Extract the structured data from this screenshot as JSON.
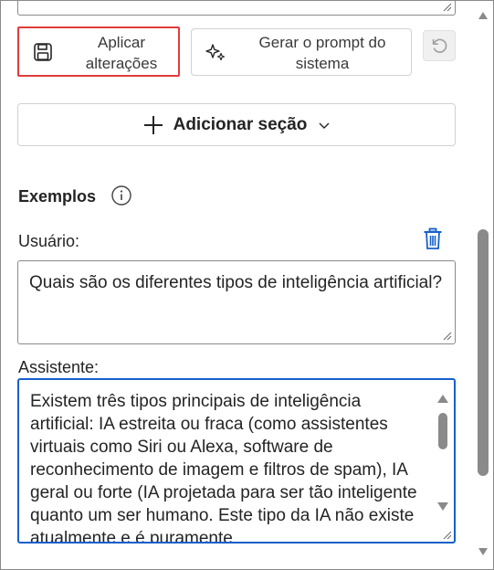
{
  "toolbar": {
    "apply_label": "Aplicar alterações",
    "apply_icon": "save-icon",
    "generate_label": "Gerar o prompt do sistema",
    "generate_icon": "sparkle-icon",
    "undo_icon": "undo-icon"
  },
  "add_section": {
    "label": "Adicionar seção",
    "icon": "plus-icon",
    "chevron": "chevron-down-icon"
  },
  "examples": {
    "title": "Exemplos",
    "info_icon": "info-icon",
    "user_label": "Usuário:",
    "user_value": "Quais são os diferentes tipos de inteligência artificial?",
    "delete_icon": "trash-icon",
    "assistant_label": "Assistente:",
    "assistant_value": "Existem três tipos principais de inteligência artificial: IA estreita ou fraca (como assistentes virtuais como Siri ou Alexa, software de reconhecimento de imagem e filtros de spam), IA geral ou forte (IA projetada para ser tão inteligente quanto um ser humano. Este tipo da IA não existe atualmente e é puramente"
  },
  "colors": {
    "highlight": "#e03c3c",
    "focus": "#1660c9",
    "delete_icon": "#1660c9",
    "scrollbar": "#8a8a8a"
  }
}
